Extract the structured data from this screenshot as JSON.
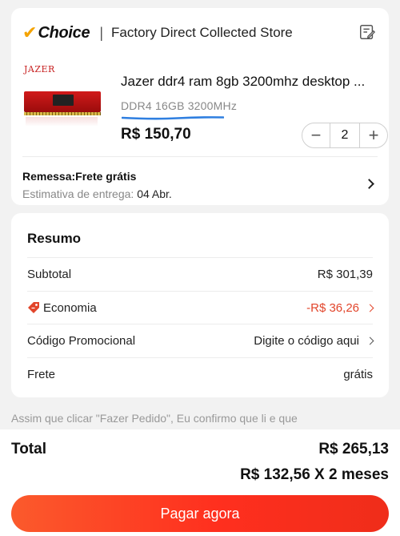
{
  "store": {
    "badge_check": "✔",
    "badge_label": "Choice",
    "separator": "|",
    "name": "Factory Direct Collected Store",
    "icon": "edit-note-icon"
  },
  "product": {
    "thumb_brand": "JAZER",
    "title": "Jazer ddr4 ram 8gb 3200mhz desktop ...",
    "variant": "DDR4 16GB 3200MHz",
    "price": "R$ 150,70",
    "quantity": "2",
    "decrement_symbol": "−",
    "increment_symbol": "+",
    "underline_color": "#2f7fe0"
  },
  "shipping": {
    "title": "Remessa:Frete grátis",
    "eta_label": "Estimativa de entrega: ",
    "eta_date": "04 Abr."
  },
  "summary": {
    "title": "Resumo",
    "rows": [
      {
        "label": "Subtotal",
        "value": "R$ 301,39"
      },
      {
        "label": "Economia",
        "value": "-R$ 36,26",
        "icon": "discount-tag-icon",
        "color": "#e2452b"
      },
      {
        "label": "Código Promocional",
        "value": "Digite o código aqui"
      },
      {
        "label": "Frete",
        "value": "grátis"
      }
    ]
  },
  "terms": "Assim que clicar \"Fazer Pedido\", Eu confirmo que li e que",
  "footer": {
    "total_label": "Total",
    "total_value": "R$ 265,13",
    "installment": "R$ 132,56 X 2 meses",
    "pay_button": "Pagar agora"
  },
  "colors": {
    "accent_orange": "#ff3d24",
    "choice_check": "#f4a300",
    "discount_red": "#e2452b"
  }
}
